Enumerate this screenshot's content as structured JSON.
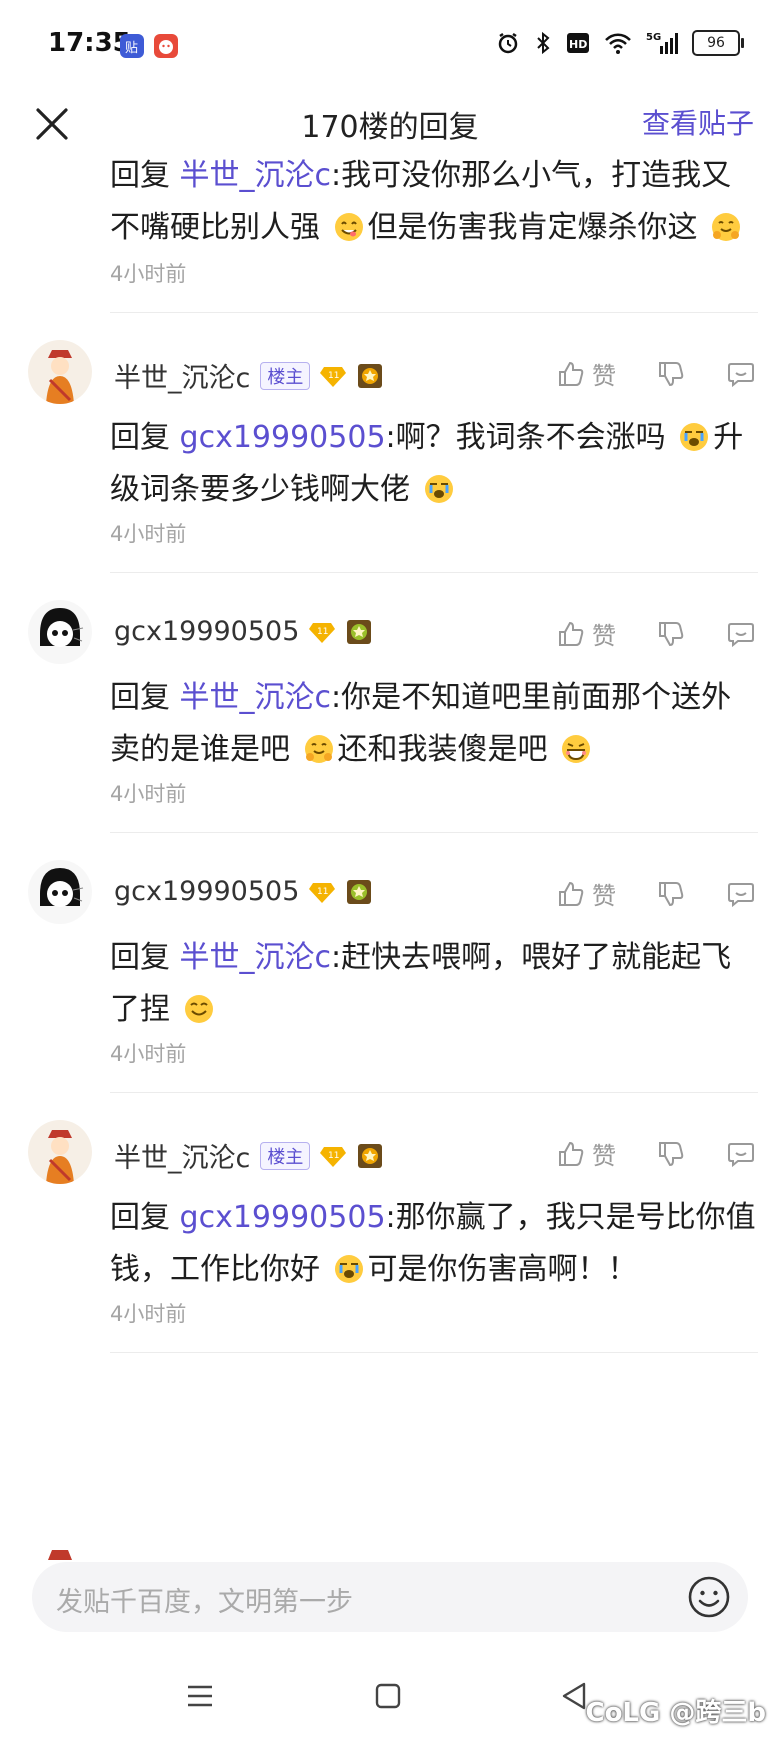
{
  "status_bar": {
    "time": "17:35",
    "battery": "96"
  },
  "header": {
    "title": "170楼的回复",
    "view_post": "查看贴子"
  },
  "first_reply": {
    "prefix": "回复",
    "mention": "半世_沉沦c",
    "text_1": ":我可没你那么小气，打造我又不嘴硬比别人强",
    "text_2": "但是伤害我肯定爆杀你这",
    "time": "4小时前"
  },
  "replies": [
    {
      "username": "半世_沉沦c",
      "is_owner": true,
      "owner_label": "楼主",
      "level": "11",
      "like_label": "赞",
      "prefix": "回复",
      "mention": "gcx19990505",
      "text_1": ":啊？我词条不会涨吗",
      "text_2": "升级词条要多少钱啊大佬",
      "text_3": "",
      "time": "4小时前"
    },
    {
      "username": "gcx19990505",
      "is_owner": false,
      "level": "11",
      "like_label": "赞",
      "prefix": "回复",
      "mention": "半世_沉沦c",
      "text_1": ":你是不知道吧里前面那个送外卖的是谁是吧",
      "text_2": "还和我装傻是吧",
      "text_3": "",
      "time": "4小时前"
    },
    {
      "username": "gcx19990505",
      "is_owner": false,
      "level": "11",
      "like_label": "赞",
      "prefix": "回复",
      "mention": "半世_沉沦c",
      "text_1": ":赶快去喂啊，喂好了就能起飞了捏",
      "text_2": "",
      "text_3": "",
      "time": "4小时前"
    },
    {
      "username": "半世_沉沦c",
      "is_owner": true,
      "owner_label": "楼主",
      "level": "11",
      "like_label": "赞",
      "prefix": "回复",
      "mention": "gcx19990505",
      "text_1": ":那你赢了，我只是号比你值钱，工作比你好",
      "text_2": "可是你伤害高啊！！",
      "text_3": "",
      "time": "4小时前"
    }
  ],
  "input": {
    "placeholder": "发贴千百度，文明第一步"
  },
  "watermark": "CoLG @跨三b",
  "colors": {
    "accent": "#5b4fd0",
    "muted": "#a5a5a5"
  }
}
